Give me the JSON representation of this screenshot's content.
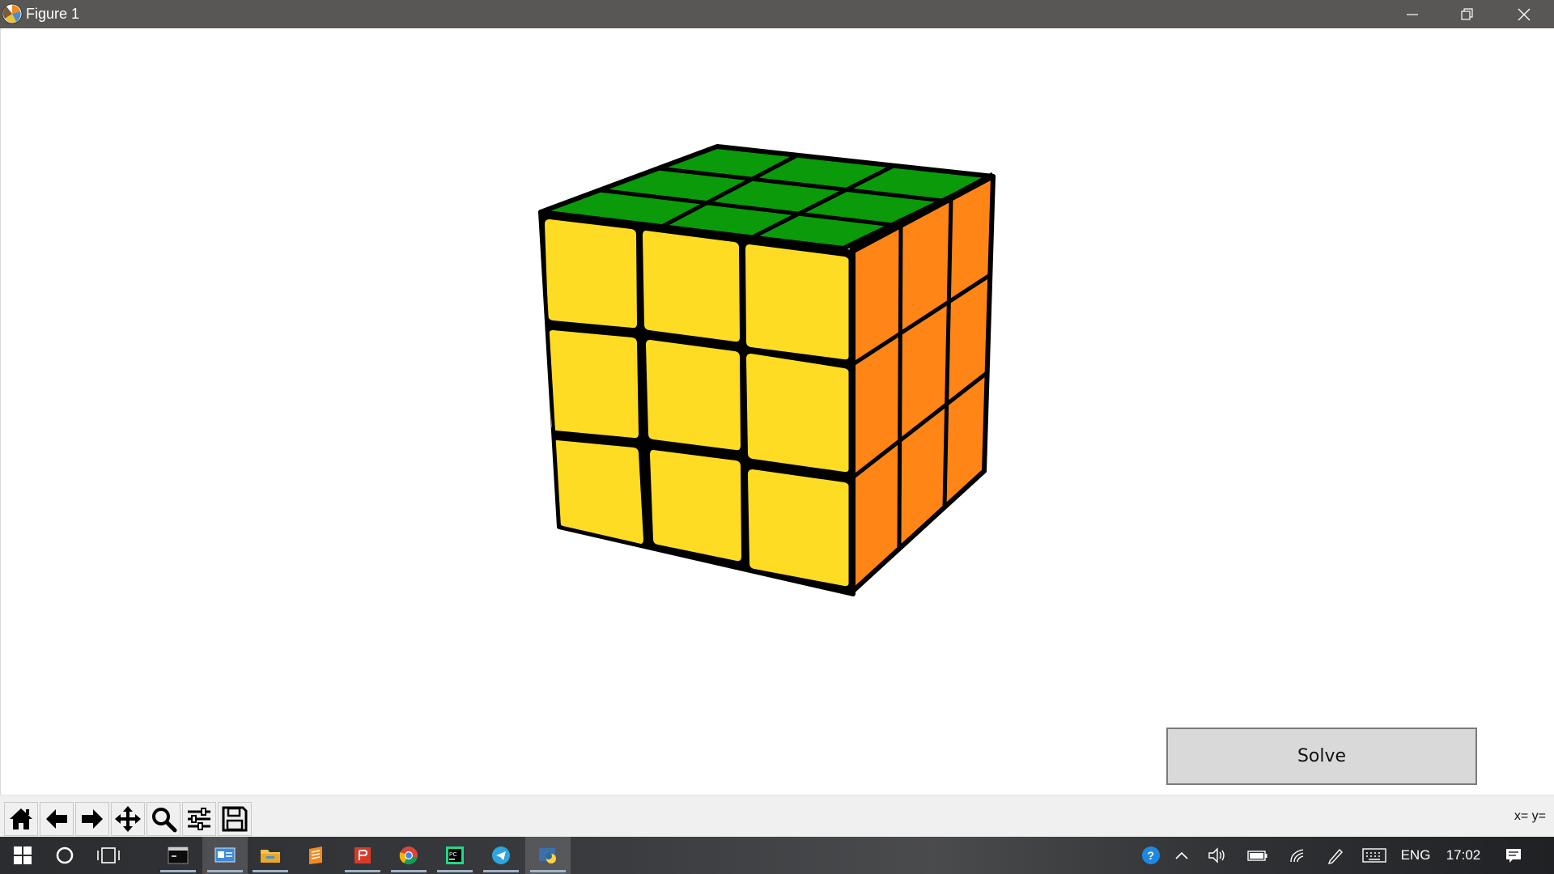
{
  "window": {
    "title": "Figure 1",
    "app_icon": "matplotlib-icon",
    "controls": [
      "minimize-icon",
      "restore-icon",
      "close-icon"
    ]
  },
  "cube": {
    "top_color": "#0a9a0a",
    "front_color": "#ffdc24",
    "right_color": "#ff8516",
    "edge_color": "#000000",
    "faces": {
      "top": [
        "green",
        "green",
        "green",
        "green",
        "green",
        "green",
        "green",
        "green",
        "green"
      ],
      "front": [
        "yellow",
        "yellow",
        "yellow",
        "yellow",
        "yellow",
        "yellow",
        "yellow",
        "yellow",
        "yellow"
      ],
      "right": [
        "orange",
        "orange",
        "orange",
        "orange",
        "orange",
        "orange",
        "orange",
        "orange",
        "orange"
      ]
    }
  },
  "solve_button": {
    "label": "Solve"
  },
  "toolbar": {
    "tools": [
      "home-icon",
      "back-arrow-icon",
      "forward-arrow-icon",
      "pan-icon",
      "zoom-icon",
      "configure-subplots-icon",
      "save-icon"
    ],
    "coords": "x= y="
  },
  "taskbar": {
    "apps": [
      "start-icon",
      "cortana-icon",
      "task-view-icon",
      "terminal-icon",
      "control-panel-icon",
      "file-explorer-icon",
      "sublime-icon",
      "app-red-icon",
      "chrome-icon",
      "pycharm-icon",
      "telegram-icon",
      "python-icon"
    ],
    "tray": {
      "language": "ENG",
      "time": "17:02"
    }
  }
}
